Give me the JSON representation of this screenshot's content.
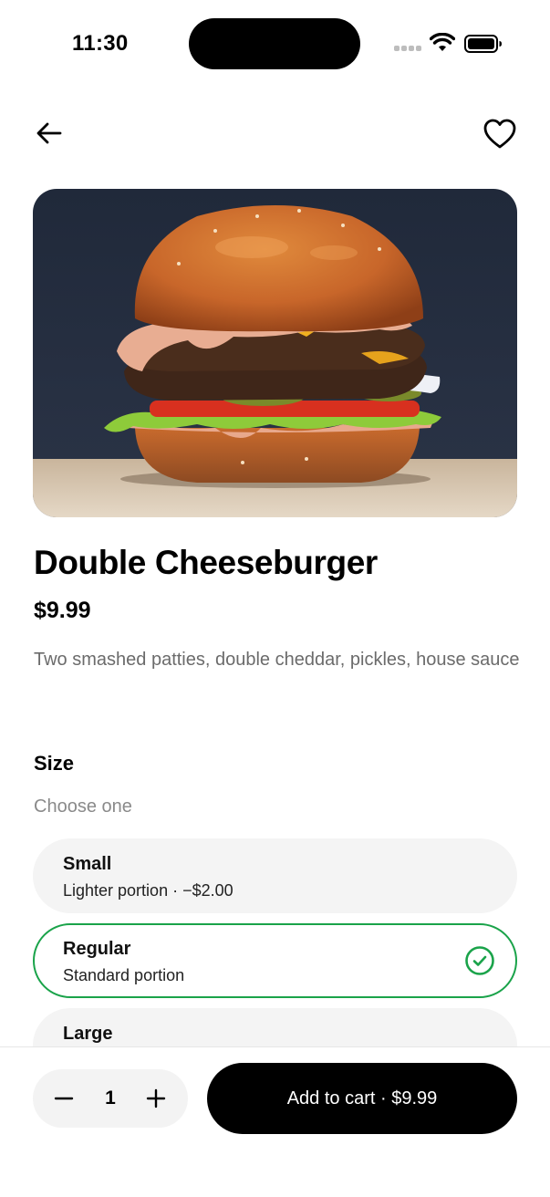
{
  "status_bar": {
    "time": "11:30"
  },
  "header": {
    "back_icon": "arrow-left-icon",
    "favorite_icon": "heart-outline-icon"
  },
  "product": {
    "image": "burger-photo",
    "title": "Double Cheeseburger",
    "price": "$9.99",
    "description": "Two smashed patties, double cheddar, pickles, house sauce"
  },
  "size_section": {
    "title": "Size",
    "subtitle": "Choose one",
    "options": [
      {
        "name": "Small",
        "detail": "Lighter portion · −$2.00",
        "selected": false
      },
      {
        "name": "Regular",
        "detail": "Standard portion",
        "selected": true
      },
      {
        "name": "Large",
        "detail": "",
        "selected": false
      }
    ]
  },
  "bottom_bar": {
    "quantity": "1",
    "add_to_cart_label": "Add to cart · $9.99"
  },
  "colors": {
    "accent_green": "#1aa34a",
    "primary_button": "#000000",
    "option_background": "#f4f4f4",
    "muted_text": "#6b6b6b"
  }
}
